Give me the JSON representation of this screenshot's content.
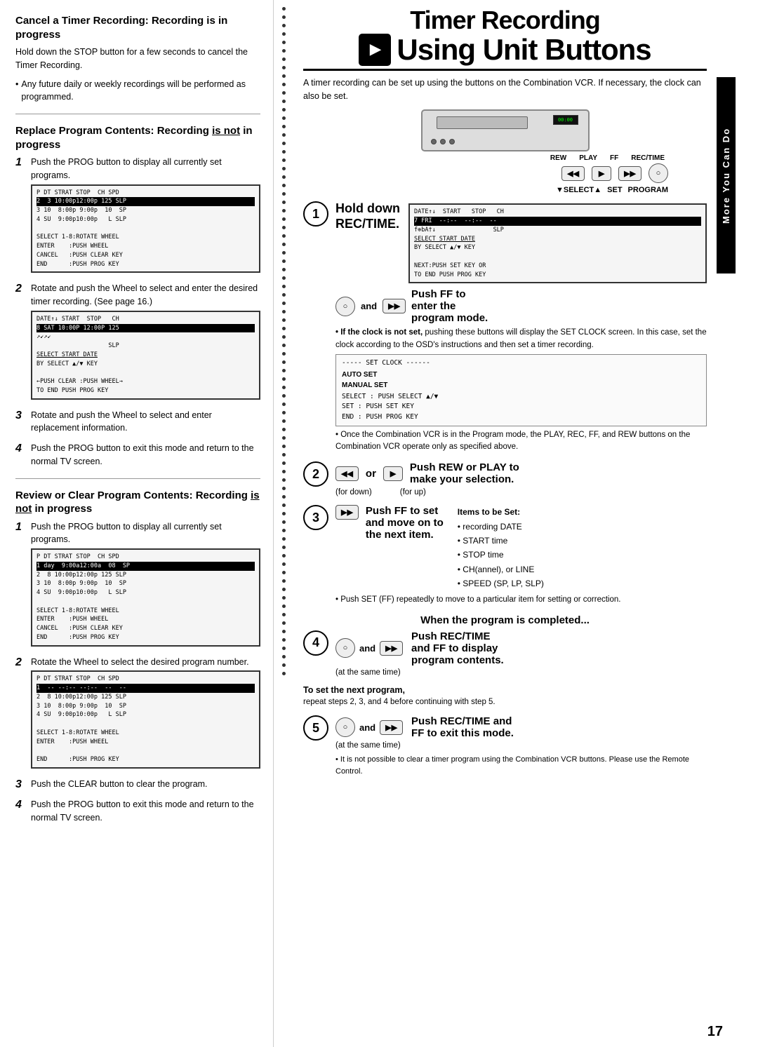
{
  "page": {
    "number": "17",
    "sidebar_label": "More You Can Do"
  },
  "title": {
    "line1": "Timer Recording",
    "line2": "Using Unit Buttons",
    "icon_symbol": "▶"
  },
  "intro": {
    "text": "A timer recording can be set up using the buttons on the Combination VCR. If necessary, the clock can also be set."
  },
  "left": {
    "section1": {
      "heading": "Cancel a Timer Recording: Recording is in progress",
      "body": "Hold down the STOP button for a few seconds to cancel the Timer Recording.",
      "bullet": "Any future daily or weekly recordings will be performed as programmed."
    },
    "divider": true,
    "section2": {
      "heading": "Replace Program Contents: Recording is not in progress",
      "steps": [
        {
          "num": "1",
          "text": "Push the PROG button to display all currently set programs.",
          "lcd1": {
            "rows": [
              "P DT STRAT STOP  CH SPD",
              "2  3 10:00p12:00p 125 SLP",
              "3 10  8:00p 9:00p  10  SP",
              "4 SU  9:00p10:00p   L SLP",
              "",
              "SELECT 1-8:ROTATE WHEEL",
              "ENTER    :PUSH WHEEL",
              "CANCEL   :PUSH CLEAR KEY",
              "END      :PUSH PROG KEY"
            ]
          }
        },
        {
          "num": "2",
          "text": "Rotate and push the Wheel to select and enter the desired timer recording. (See page 16.)",
          "lcd2": {
            "rows": [
              "DATE↑↓ START  STOP  CH",
              "8 SAT 10:00P 12:00P 125",
              "↗↙↗↙",
              "",
              "                    SLP",
              "SELECT START DATE",
              "BY SELECT ▲/▼ KEY",
              "",
              "←PUSH CLEAR :PUSH WHEEL→",
              "TO END PUSH PROG KEY"
            ]
          }
        },
        {
          "num": "3",
          "text": "Rotate and push the Wheel to select and enter replacement information."
        },
        {
          "num": "4",
          "text": "Push the PROG button to exit this mode and return to the normal TV screen."
        }
      ]
    },
    "divider2": true,
    "section3": {
      "heading": "Review or Clear Program Contents: Recording is not in progress",
      "steps": [
        {
          "num": "1",
          "text": "Push the PROG button to display all currently set programs.",
          "lcd1": {
            "rows": [
              "P DT STRAT STOP  CH SPD",
              "1 day  9:00a12:00a  08  SP",
              "2  8 10:00p12:00p 125 SLP",
              "3 10  8:00p 9:00p  10  SP",
              "4 SU  9:00p10:00p   L SLP",
              "",
              "SELECT 1-8:ROTATE WHEEL",
              "ENTER    :PUSH WHEEL",
              "CANCEL   :PUSH CLEAR KEY",
              "END      :PUSH PROG KEY"
            ]
          }
        },
        {
          "num": "2",
          "text": "Rotate the Wheel to select the desired program number.",
          "lcd2": {
            "rows": [
              "P DT STRAT STOP  CH SPD",
              "1  -- --:-- --:--  --  --",
              "2  8 10:00p12:00p 125 SLP",
              "3 10  8:00p 9:00p  10  SP",
              "4 SU  9:00p10:00p   L SLP",
              "",
              "SELECT 1-8:ROTATE WHEEL",
              "ENTER    :PUSH WHEEL",
              "",
              "END      :PUSH PROG KEY"
            ]
          }
        },
        {
          "num": "3",
          "text": "Push the CLEAR button to clear the program."
        },
        {
          "num": "4",
          "text": "Push the PROG button to exit this mode and return to the normal TV screen."
        }
      ]
    }
  },
  "right": {
    "transport_labels": [
      "REW",
      "PLAY",
      "FF",
      "REC/TIME"
    ],
    "transport_buttons": [
      "◀◀",
      "▶",
      "▶▶",
      "○"
    ],
    "select_label": "▼SELECT▲",
    "set_label": "SET",
    "program_label": "PROGRAM",
    "step1": {
      "circle": "1",
      "main_text_line1": "Hold down",
      "main_text_line2": "REC/TIME.",
      "and_text": "and",
      "sub_text": "Push FF to enter the program mode.",
      "lcd": {
        "rows": [
          "DATE↑↓  START   STOP   CH",
          "7 FRI  --:--  --:--  --",
          "f⊕bA†↓                SLP",
          "SELECT START DATE",
          "BY SELECT ▲/▼ KEY",
          "",
          "NEXT:PUSH SET KEY OR",
          "TO END PUSH PROG KEY"
        ]
      },
      "note_bold": "If the clock is not set,",
      "note_text": " pushing these buttons will display the SET CLOCK screen. In this case, set the clock according to the OSD's instructions and then set a timer recording.",
      "clock_box": {
        "title": "----- SET CLOCK ------",
        "rows": [
          "AUTO SET",
          "MANUAL SET",
          "",
          "SELECT : PUSH SELECT ▲/▼",
          "SET    : PUSH SET KEY",
          "END    : PUSH PROG KEY"
        ]
      },
      "note2": "Once the Combination VCR is in the Program mode, the PLAY, REC, FF, and REW buttons on the Combination VCR operate only as specified above."
    },
    "step2": {
      "circle": "2",
      "main_text": "Push REW or PLAY to make your selection.",
      "or_text": "or",
      "for_down": "(for down)",
      "for_up": "(for up)"
    },
    "step3": {
      "circle": "3",
      "main_text_line1": "Push FF to set",
      "main_text_line2": "and move on to",
      "main_text_line3": "the next item.",
      "items_title": "Items to be Set:",
      "items": [
        "• recording DATE",
        "• START time",
        "• STOP time",
        "• CH(annel), or LINE",
        "• SPEED (SP, LP, SLP)"
      ],
      "note": "Push SET (FF) repeatedly to move to a particular item for setting or correction."
    },
    "when_completed": "When the program is completed...",
    "step4": {
      "circle": "4",
      "main_text_line1": "Push REC/TIME",
      "main_text_line2": "and FF to display",
      "main_text_line3": "program contents.",
      "and_text": "and",
      "sub": "(at the same time)"
    },
    "to_set_next": {
      "label": "To set the next program,",
      "text": "repeat steps 2, 3, and 4 before continuing with step 5."
    },
    "step5": {
      "circle": "5",
      "main_text_line1": "Push REC/TIME and",
      "main_text_line2": "FF to exit this mode.",
      "and_text": "and",
      "sub": "(at the same time)",
      "note": "It is not possible to clear a timer program using the Combination VCR buttons. Please use the Remote Control."
    }
  }
}
